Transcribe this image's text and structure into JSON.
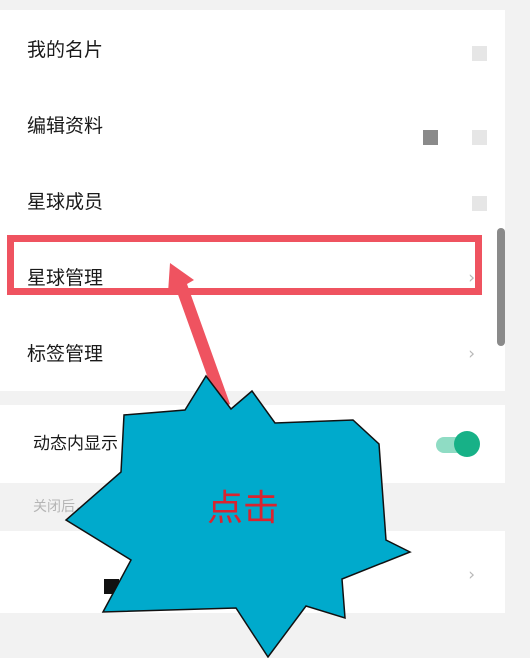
{
  "menu": {
    "items": [
      {
        "label": "我的名片"
      },
      {
        "label": "编辑资料"
      },
      {
        "label": "星球成员"
      },
      {
        "label": "星球管理",
        "chevron": "›"
      },
      {
        "label": "标签管理",
        "chevron": "›"
      }
    ]
  },
  "settings": {
    "dynamic_label": "动态内显示",
    "toggle_on": true,
    "accent_color": "#17b187",
    "hint": "关闭后，",
    "extra_chevron": "›"
  },
  "annotation": {
    "text": "点击",
    "highlight_color": "#ef5360",
    "burst_color": "#00aacc"
  }
}
